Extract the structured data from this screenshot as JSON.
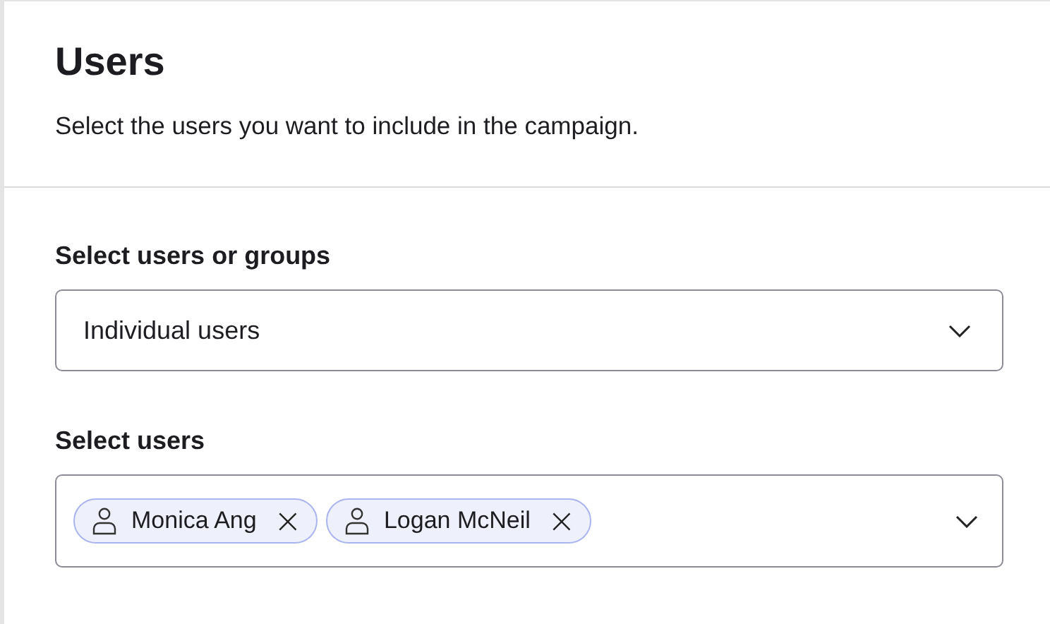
{
  "header": {
    "title": "Users",
    "description": "Select the users you want to include in the campaign."
  },
  "fields": [
    {
      "kind": "select",
      "label": "Select users or groups",
      "value": "Individual users"
    },
    {
      "kind": "multiselect",
      "label": "Select users",
      "chips": [
        {
          "label": "Monica Ang",
          "remove": "×"
        },
        {
          "label": "Logan McNeil",
          "remove": "×"
        }
      ]
    }
  ]
}
